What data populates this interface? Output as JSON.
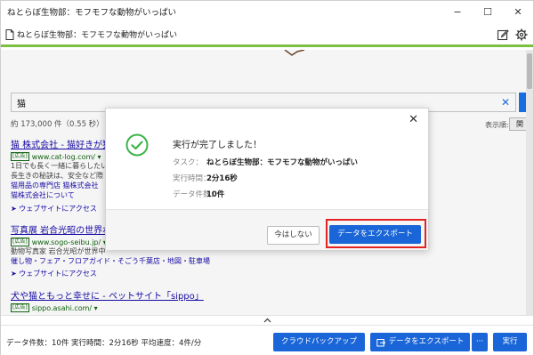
{
  "window": {
    "title": "ねとらぼ生物部：モフモフな動物がいっぱい",
    "minimize": "−",
    "maximize": "☐",
    "close": "✕"
  },
  "tab": {
    "label": "ねとらぼ生物部：モフモフな動物がいっぱい"
  },
  "browser": {
    "search_query": "猫",
    "result_count": "約 173,000 件（0.55 秒）",
    "sort_label": "表示順:",
    "sort_value": "関",
    "results": [
      {
        "title": "猫 株式会社 - 猫好きが猫",
        "badge": "[広告]",
        "url": "www.cat-log.com/ ▾",
        "desc": [
          "1日でも長く一緒に暮らしたい",
          "長生きの秘訣は、安全など際"
        ],
        "links": [
          "猫用品の専門店 猫株式会社",
          "猫株式会社について"
        ],
        "access": "➤ ウェブサイトにアクセス"
      },
      {
        "title": "写真展 岩合光昭の世界ね",
        "badge": "[広告]",
        "url": "www.sogo-seibu.jp/ ▾",
        "desc": [
          "動物写真家 岩合光昭が世界中"
        ],
        "links": [
          "催し物・フェア・フロアガイド・そごう千葉店・地図・駐車場"
        ],
        "access": "➤ ウェブサイトにアクセス"
      },
      {
        "title": "犬や猫ともっと幸せに - ペットサイト「sippo」",
        "badge": "[広告]",
        "url": "sippo.asahi.com/ ▾"
      }
    ]
  },
  "dialog": {
    "close_icon": "✕",
    "heading": "実行が完了しました！",
    "task_label": "タスク：",
    "task_value": "ねとらぼ生物部：モフモフな動物がいっぱい",
    "time_label": "実行時間：",
    "time_value": "2分16秒",
    "count_label": "データ件数：",
    "count_value": "10件",
    "later_button": "今はしない",
    "export_button": "データをエクスポート"
  },
  "statusbar": {
    "stats": "データ件数：10件 実行時間：2分16秒 平均速度：4件/分",
    "cloud_backup": "クラウドバックアップ",
    "export": "データをエクスポート",
    "more": "···",
    "run": "実行"
  },
  "colors": {
    "accent_blue": "#1a66d8",
    "highlight_red": "#e52222",
    "tab_underline_green": "#7bc043",
    "check_green": "#3cb549"
  }
}
